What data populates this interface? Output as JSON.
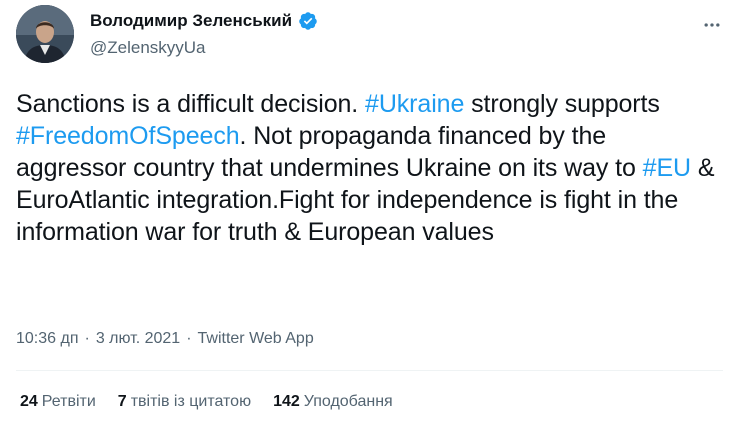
{
  "author": {
    "display_name": "Володимир Зеленський",
    "handle": "@ZelenskyyUa",
    "verified": true,
    "avatar_icon": "profile-photo",
    "verified_icon": "verified-badge-icon"
  },
  "tweet": {
    "text_segments": [
      {
        "text": "Sanctions is a difficult decision. ",
        "type": "text"
      },
      {
        "text": "#Ukraine",
        "type": "hashtag"
      },
      {
        "text": " strongly supports ",
        "type": "text"
      },
      {
        "text": "#FreedomOfSpeech",
        "type": "hashtag"
      },
      {
        "text": ". Not propaganda financed by the aggressor country that undermines Ukraine on its way to ",
        "type": "text"
      },
      {
        "text": "#EU",
        "type": "hashtag"
      },
      {
        "text": " & EuroAtlantic integration.Fight for independence is fight in the information war for truth & European values",
        "type": "text"
      }
    ],
    "time": "10:36 дп",
    "separator": "·",
    "date": "3 лют. 2021",
    "source": "Twitter Web App"
  },
  "stats": {
    "retweets_count": "24",
    "retweets_label": "Ретвіти",
    "quotes_count": "7",
    "quotes_label": "твітів із цитатою",
    "likes_count": "142",
    "likes_label": "Уподобання"
  },
  "colors": {
    "hashtag": "#1d9bf0",
    "verified": "#1d9bf0",
    "secondary_text": "#536471",
    "primary_text": "#0f1419"
  },
  "icons": {
    "more": "more-options-icon"
  }
}
